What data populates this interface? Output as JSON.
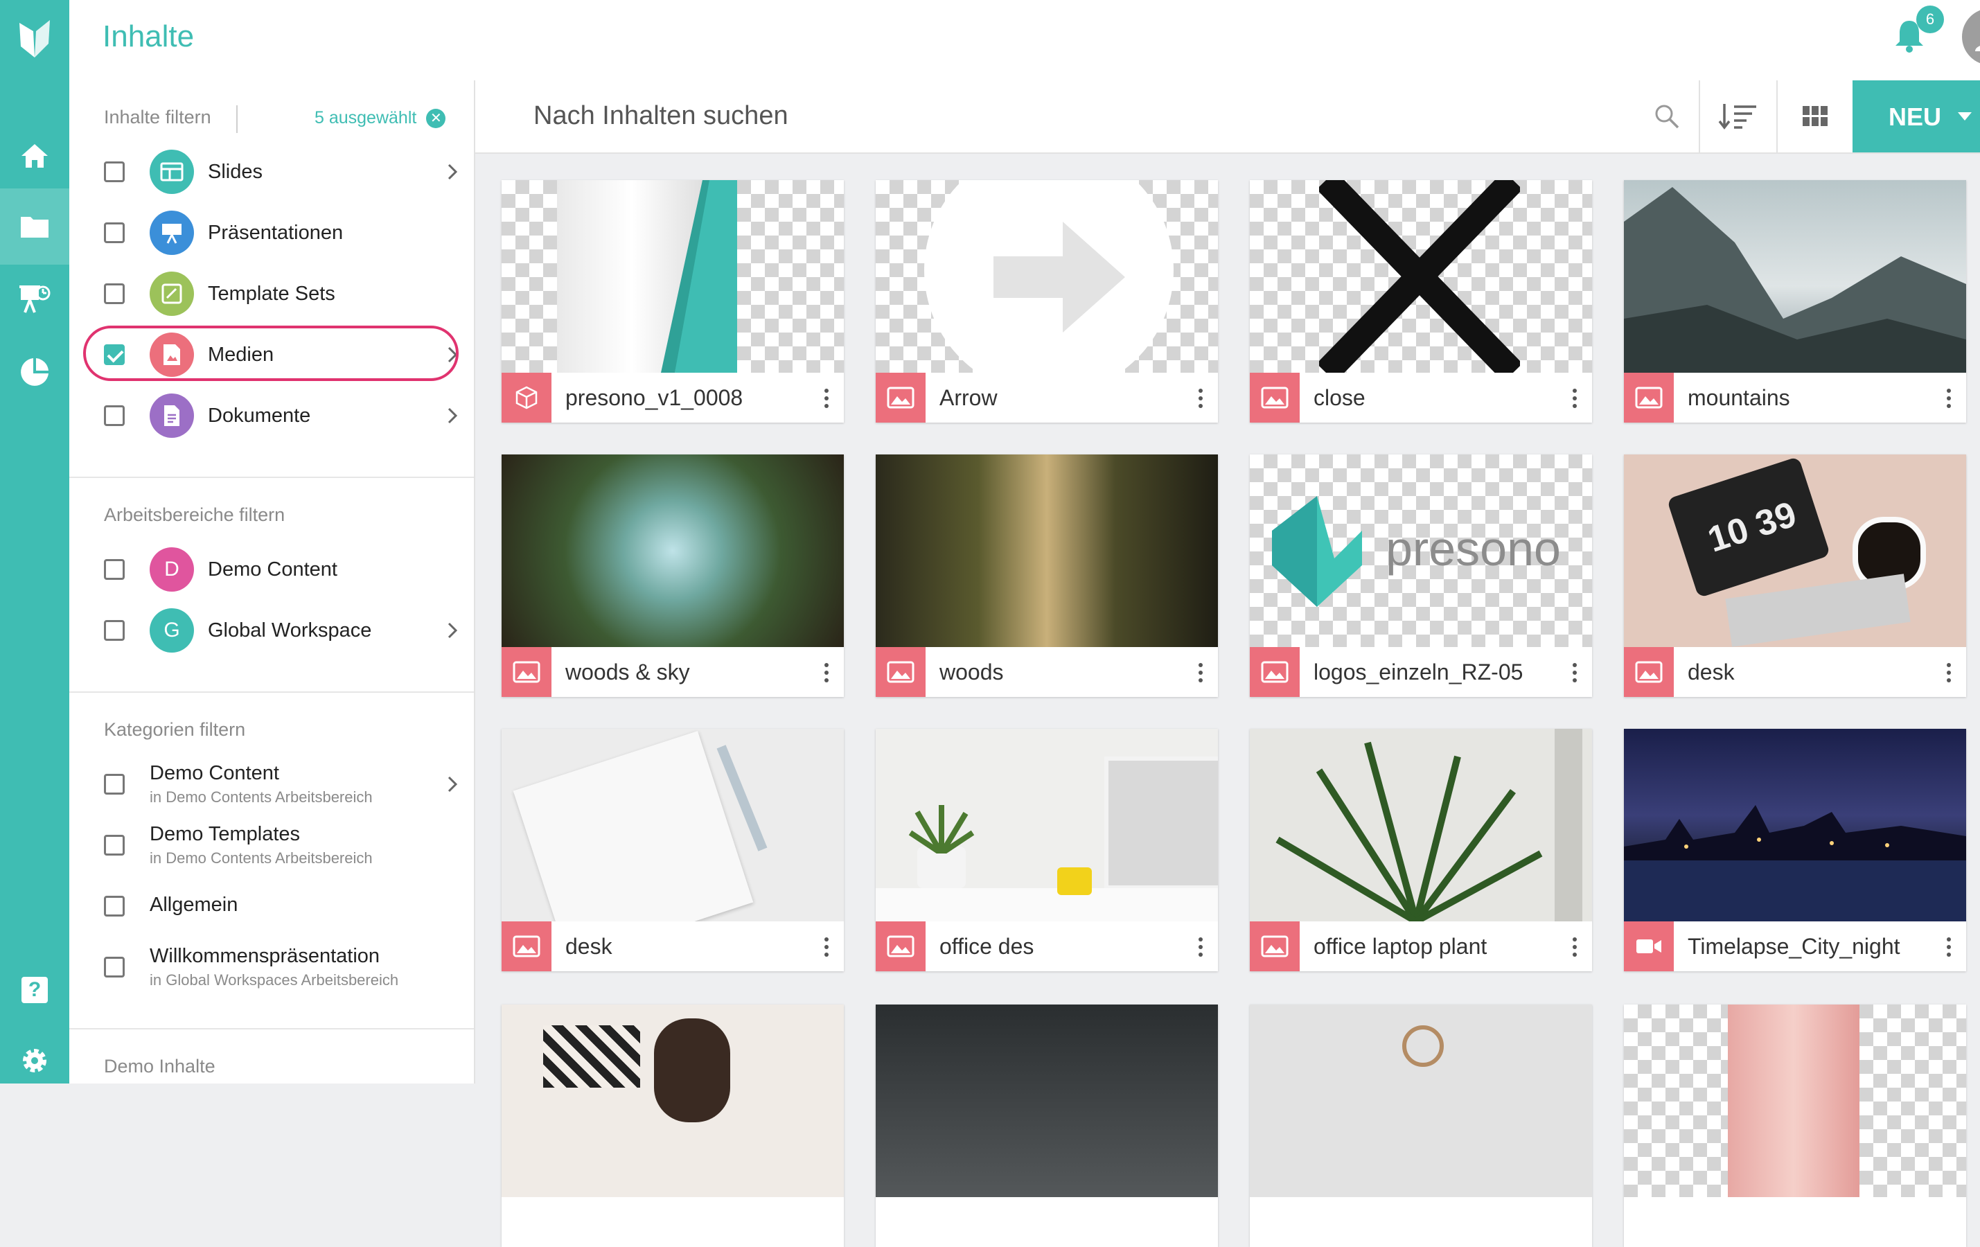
{
  "header": {
    "title": "Inhalte",
    "notification_count": "6"
  },
  "nav": [
    {
      "icon": "home-icon"
    },
    {
      "icon": "folder-icon",
      "active": true
    },
    {
      "icon": "presentation-icon"
    },
    {
      "icon": "pie-chart-icon"
    },
    {
      "icon": "help-icon"
    },
    {
      "icon": "gear-icon"
    }
  ],
  "filter": {
    "content_title": "Inhalte filtern",
    "selected": "5 ausgewählt",
    "content_items": [
      {
        "label": "Slides",
        "checked": false,
        "color": "#3fbdb3",
        "chevron": true
      },
      {
        "label": "Präsentationen",
        "checked": false,
        "color": "#3b8fd9",
        "chevron": false
      },
      {
        "label": "Template Sets",
        "checked": false,
        "color": "#9cc25a",
        "chevron": false
      },
      {
        "label": "Medien",
        "checked": true,
        "color": "#ec6f7c",
        "chevron": true
      },
      {
        "label": "Dokumente",
        "checked": false,
        "color": "#9c6fc6",
        "chevron": true
      }
    ],
    "workspace_title": "Arbeitsbereiche filtern",
    "workspace_items": [
      {
        "label": "Demo Content",
        "initial": "D",
        "color": "#e0559e",
        "chevron": false
      },
      {
        "label": "Global Workspace",
        "initial": "G",
        "color": "#3fbdb3",
        "chevron": true
      }
    ],
    "category_title": "Kategorien filtern",
    "category_items": [
      {
        "label": "Demo Content",
        "sub": "in Demo Contents Arbeitsbereich",
        "chevron": true
      },
      {
        "label": "Demo Templates",
        "sub": "in Demo Contents Arbeitsbereich",
        "chevron": false
      },
      {
        "label": "Allgemein",
        "sub": "",
        "chevron": false
      },
      {
        "label": "Willkommenspräsentation",
        "sub": "in Global Workspaces Arbeitsbereich",
        "chevron": false
      }
    ],
    "demo_title": "Demo Inhalte"
  },
  "search": {
    "placeholder": "Nach Inhalten suchen",
    "new_button": "NEU"
  },
  "cards": [
    {
      "name": "presono_v1_0008",
      "type": "3d"
    },
    {
      "name": "Arrow",
      "type": "image"
    },
    {
      "name": "close",
      "type": "image"
    },
    {
      "name": "mountains",
      "type": "image"
    },
    {
      "name": "woods & sky",
      "type": "image"
    },
    {
      "name": "woods",
      "type": "image"
    },
    {
      "name": "logos_einzeln_RZ-05",
      "type": "image"
    },
    {
      "name": "desk",
      "type": "image"
    },
    {
      "name": "desk",
      "type": "image"
    },
    {
      "name": "office des",
      "type": "image"
    },
    {
      "name": "office laptop plant",
      "type": "image"
    },
    {
      "name": "Timelapse_City_night",
      "type": "video"
    }
  ],
  "thumb_texts": {
    "logo_word": "presono",
    "clock": "10 39"
  }
}
